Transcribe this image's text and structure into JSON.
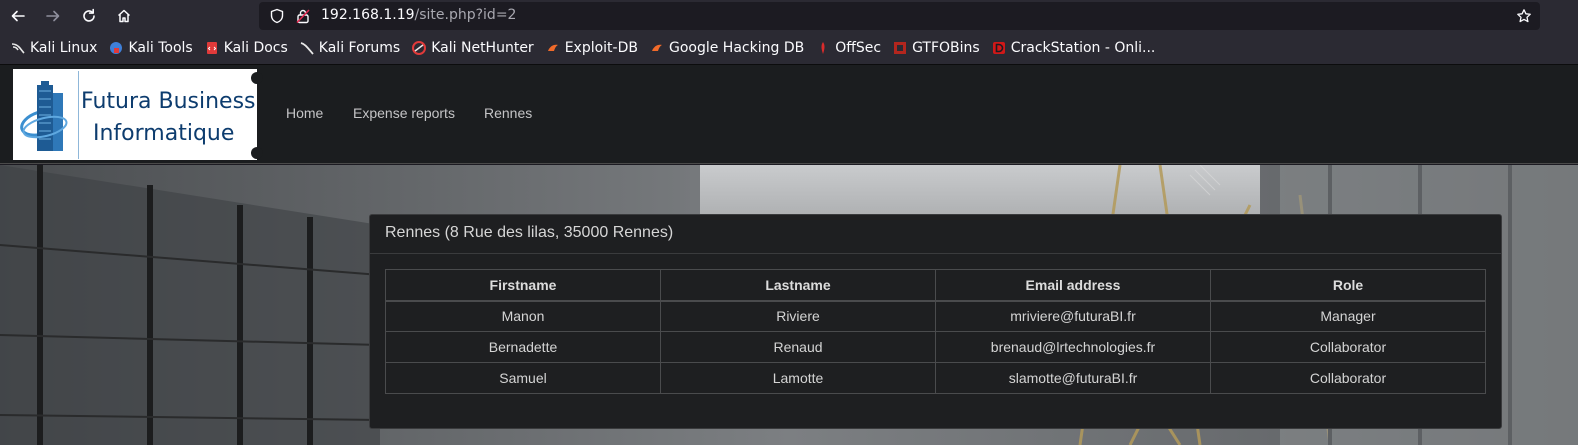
{
  "browser": {
    "url_host": "192.168.1.19",
    "url_path": "/site.php?id=2"
  },
  "bookmarks": [
    {
      "label": "Kali Linux",
      "icon": "kali-dragon-icon",
      "color": "#e8e8e8"
    },
    {
      "label": "Kali Tools",
      "icon": "kali-tools-icon",
      "color": "#3f7fd8"
    },
    {
      "label": "Kali Docs",
      "icon": "kali-docs-icon",
      "color": "#e03a3a"
    },
    {
      "label": "Kali Forums",
      "icon": "kali-forums-icon",
      "color": "#e8e8e8"
    },
    {
      "label": "Kali NetHunter",
      "icon": "nethunter-icon",
      "color": "#e03a3a"
    },
    {
      "label": "Exploit-DB",
      "icon": "exploit-db-icon",
      "color": "#f06a2a"
    },
    {
      "label": "Google Hacking DB",
      "icon": "ghdb-icon",
      "color": "#f06a2a"
    },
    {
      "label": "OffSec",
      "icon": "offsec-icon",
      "color": "#d92b2b"
    },
    {
      "label": "GTFOBins",
      "icon": "gtfobins-icon",
      "color": "#b3261e"
    },
    {
      "label": "CrackStation - Onli...",
      "icon": "crackstation-icon",
      "color": "#d01818"
    }
  ],
  "site": {
    "logo_line1": "Futura Business",
    "logo_line2": "Informatique",
    "menu": {
      "home": "Home",
      "expense_reports": "Expense reports",
      "rennes": "Rennes"
    }
  },
  "card": {
    "title": "Rennes (8 Rue des lilas, 35000 Rennes)",
    "headers": {
      "firstname": "Firstname",
      "lastname": "Lastname",
      "email": "Email address",
      "role": "Role"
    },
    "rows": [
      {
        "firstname": "Manon",
        "lastname": "Riviere",
        "email": "mriviere@futuraBI.fr",
        "role": "Manager"
      },
      {
        "firstname": "Bernadette",
        "lastname": "Renaud",
        "email": "brenaud@lrtechnologies.fr",
        "role": "Collaborator"
      },
      {
        "firstname": "Samuel",
        "lastname": "Lamotte",
        "email": "slamotte@futuraBI.fr",
        "role": "Collaborator"
      }
    ]
  }
}
